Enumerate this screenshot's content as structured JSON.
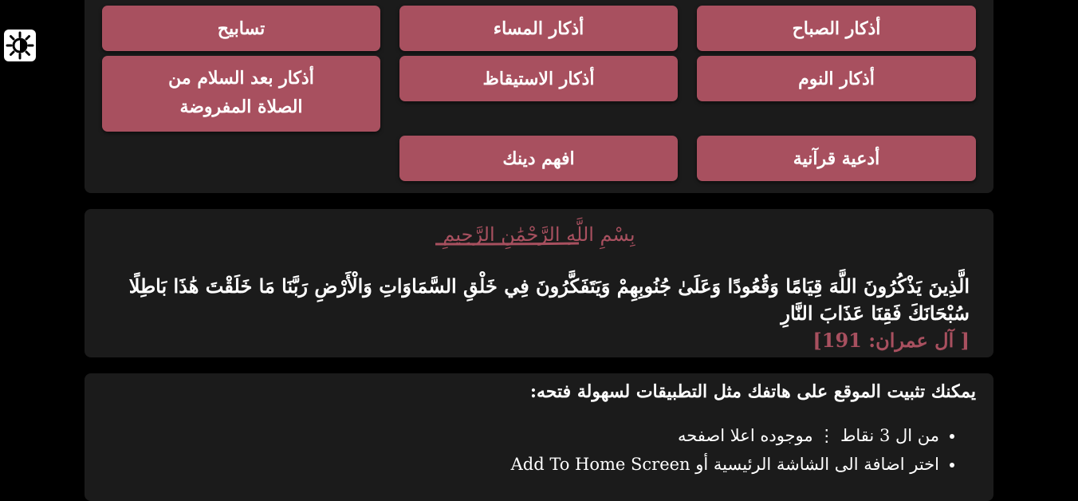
{
  "theme_toggle": {
    "icon": "sun-icon"
  },
  "menu": {
    "buttons": [
      {
        "label": "أذكار الصباح"
      },
      {
        "label": "أذكار المساء"
      },
      {
        "label": "تسابيح"
      },
      {
        "label": "أذكار النوم"
      },
      {
        "label": "أذكار الاستيقاظ"
      },
      {
        "label": "أذكار بعد السلام من الصلاة المفروضة"
      },
      {
        "label": "أدعية قرآنية"
      },
      {
        "label": "افهم دينك"
      }
    ]
  },
  "verse_section": {
    "basmala": "بِسْمِ اللَّهِ الرَّحْمَٰنِ الرَّحِيمِ",
    "verse": "الَّذِينَ يَذْكُرُونَ اللَّهَ قِيَامًا وَقُعُودًا وَعَلَىٰ جُنُوبِهِمْ وَيَتَفَكَّرُونَ فِي خَلْقِ السَّمَاوَاتِ وَالْأَرْضِ رَبَّنَا مَا خَلَقْتَ هَٰذَا بَاطِلًا سُبْحَانَكَ فَقِنَا عَذَابَ النَّارِ",
    "reference": "[ آل عمران: 191]"
  },
  "install_section": {
    "title": "يمكنك تثبيت الموقع على هاتفك مثل التطبيقات لسهولة فتحه:",
    "steps": [
      "من ال 3 نقاط ⋮ موجوده اعلا اصفحه",
      "اختر اضافة الى الشاشة الرئيسية أو Add To Home Screen"
    ]
  },
  "colors": {
    "page_background": "#000000",
    "card_background": "#1b1b1b",
    "accent": "#a8505f",
    "text": "#ffffff"
  }
}
